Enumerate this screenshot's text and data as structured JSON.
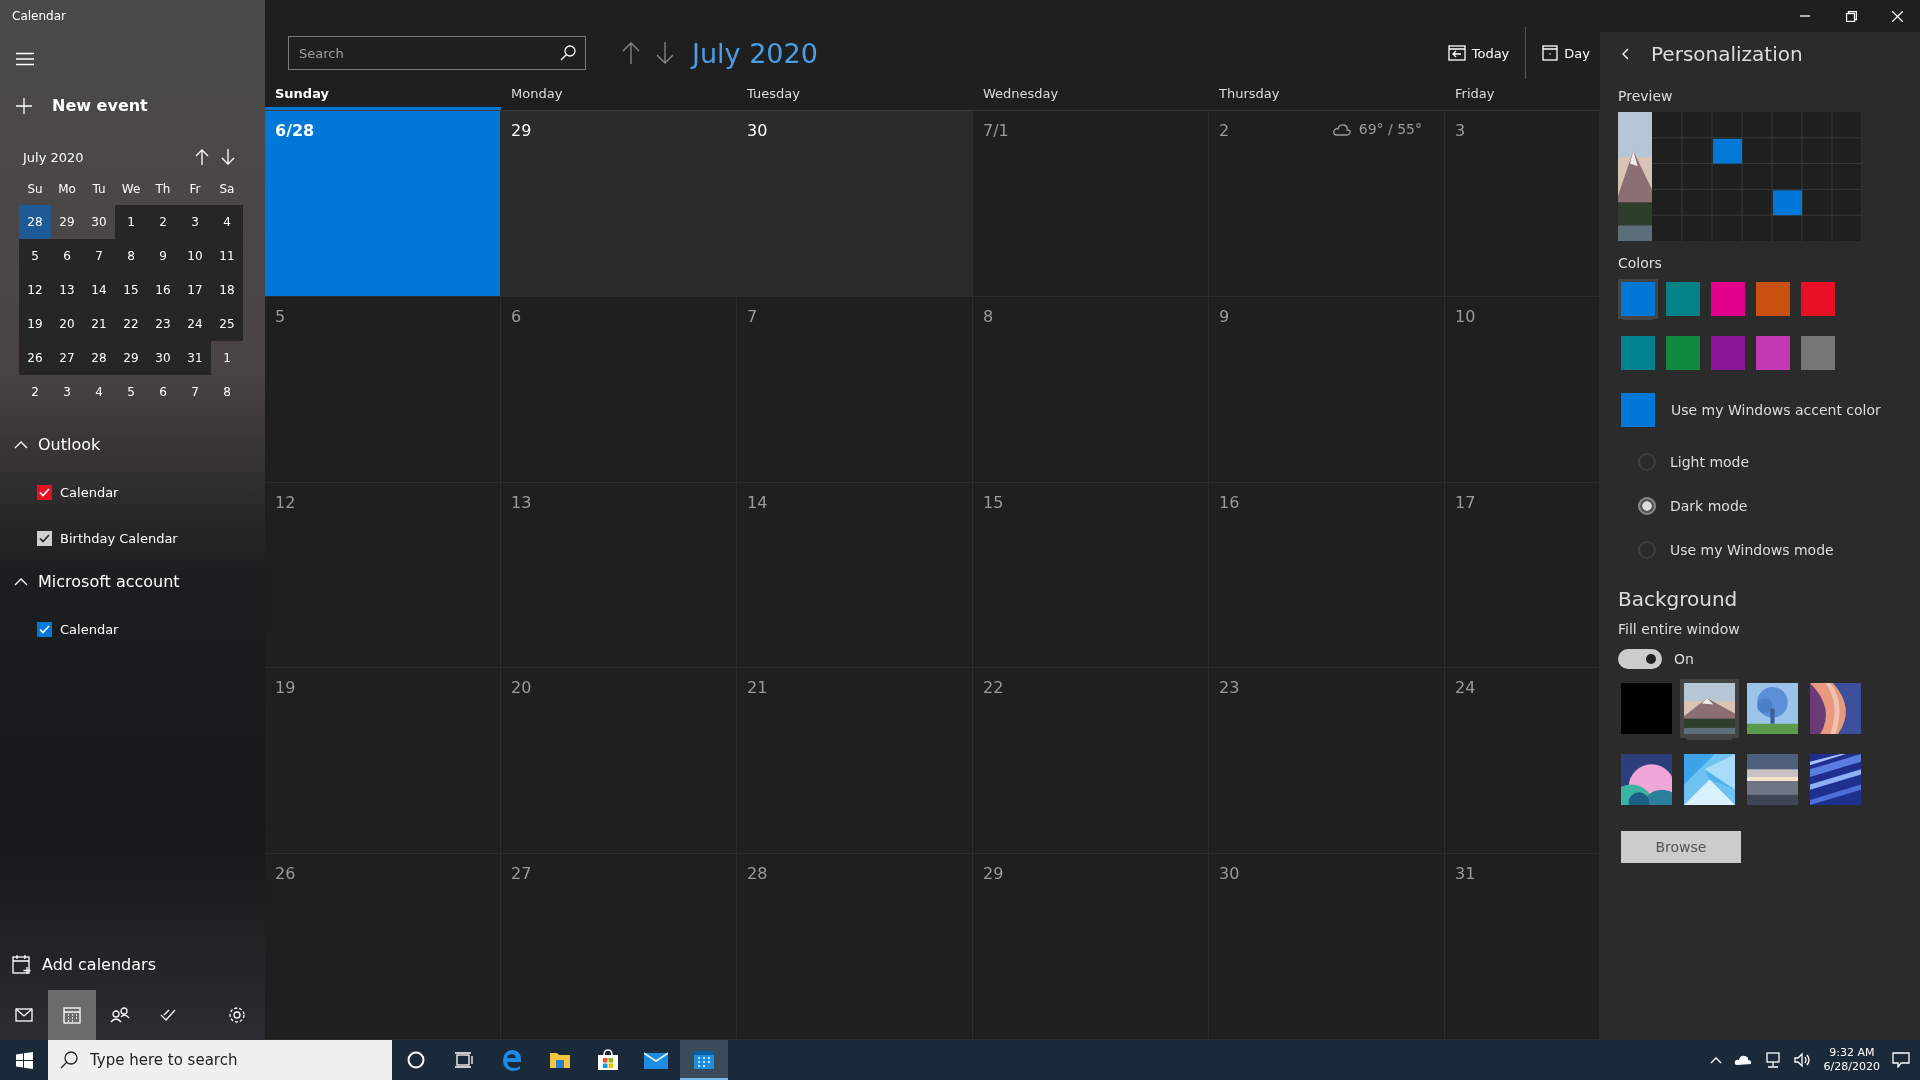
{
  "window": {
    "title": "Calendar"
  },
  "sidebar": {
    "new_event": "New event",
    "mini_calendar": {
      "title": "July 2020",
      "weekdays": [
        "Su",
        "Mo",
        "Tu",
        "We",
        "Th",
        "Fr",
        "Sa"
      ],
      "weeks": [
        [
          {
            "day": "28",
            "in_month": false,
            "selected": true
          },
          {
            "day": "29",
            "in_month": false,
            "selected": false
          },
          {
            "day": "30",
            "in_month": false,
            "selected": false
          },
          {
            "day": "1",
            "in_month": true,
            "selected": false
          },
          {
            "day": "2",
            "in_month": true,
            "selected": false
          },
          {
            "day": "3",
            "in_month": true,
            "selected": false
          },
          {
            "day": "4",
            "in_month": true,
            "selected": false
          }
        ],
        [
          {
            "day": "5",
            "in_month": true,
            "selected": false
          },
          {
            "day": "6",
            "in_month": true,
            "selected": false
          },
          {
            "day": "7",
            "in_month": true,
            "selected": false
          },
          {
            "day": "8",
            "in_month": true,
            "selected": false
          },
          {
            "day": "9",
            "in_month": true,
            "selected": false
          },
          {
            "day": "10",
            "in_month": true,
            "selected": false
          },
          {
            "day": "11",
            "in_month": true,
            "selected": false
          }
        ],
        [
          {
            "day": "12",
            "in_month": true,
            "selected": false
          },
          {
            "day": "13",
            "in_month": true,
            "selected": false
          },
          {
            "day": "14",
            "in_month": true,
            "selected": false
          },
          {
            "day": "15",
            "in_month": true,
            "selected": false
          },
          {
            "day": "16",
            "in_month": true,
            "selected": false
          },
          {
            "day": "17",
            "in_month": true,
            "selected": false
          },
          {
            "day": "18",
            "in_month": true,
            "selected": false
          }
        ],
        [
          {
            "day": "19",
            "in_month": true,
            "selected": false
          },
          {
            "day": "20",
            "in_month": true,
            "selected": false
          },
          {
            "day": "21",
            "in_month": true,
            "selected": false
          },
          {
            "day": "22",
            "in_month": true,
            "selected": false
          },
          {
            "day": "23",
            "in_month": true,
            "selected": false
          },
          {
            "day": "24",
            "in_month": true,
            "selected": false
          },
          {
            "day": "25",
            "in_month": true,
            "selected": false
          }
        ],
        [
          {
            "day": "26",
            "in_month": true,
            "selected": false
          },
          {
            "day": "27",
            "in_month": true,
            "selected": false
          },
          {
            "day": "28",
            "in_month": true,
            "selected": false
          },
          {
            "day": "29",
            "in_month": true,
            "selected": false
          },
          {
            "day": "30",
            "in_month": true,
            "selected": false
          },
          {
            "day": "31",
            "in_month": true,
            "selected": false
          },
          {
            "day": "1",
            "in_month": false,
            "selected": false
          }
        ],
        [
          {
            "day": "2",
            "in_month": false,
            "selected": false
          },
          {
            "day": "3",
            "in_month": false,
            "selected": false
          },
          {
            "day": "4",
            "in_month": false,
            "selected": false
          },
          {
            "day": "5",
            "in_month": false,
            "selected": false
          },
          {
            "day": "6",
            "in_month": false,
            "selected": false
          },
          {
            "day": "7",
            "in_month": false,
            "selected": false
          },
          {
            "day": "8",
            "in_month": false,
            "selected": false
          }
        ]
      ]
    },
    "accounts": [
      {
        "name": "Outlook",
        "expanded": true,
        "calendars": [
          {
            "name": "Calendar",
            "checked": true,
            "color": "#e81123"
          },
          {
            "name": "Birthday Calendar",
            "checked": true,
            "color": "#d0d0d0"
          }
        ]
      },
      {
        "name": "Microsoft account",
        "expanded": true,
        "calendars": [
          {
            "name": "Calendar",
            "checked": true,
            "color": "#0078d7"
          }
        ]
      }
    ],
    "add_calendars": "Add calendars",
    "nav": [
      {
        "kind": "mail",
        "selected": false
      },
      {
        "kind": "calendar",
        "selected": true
      },
      {
        "kind": "people",
        "selected": false
      },
      {
        "kind": "todo",
        "selected": false
      },
      {
        "kind": "settings",
        "selected": false
      }
    ]
  },
  "toolbar": {
    "search_placeholder": "Search",
    "title": "July 2020",
    "buttons": [
      {
        "kind": "today",
        "label": "Today"
      },
      {
        "kind": "day",
        "label": "Day"
      }
    ]
  },
  "month": {
    "weekdays": [
      {
        "label": "Sunday",
        "selected": true
      },
      {
        "label": "Monday",
        "selected": false
      },
      {
        "label": "Tuesday",
        "selected": false
      },
      {
        "label": "Wednesday",
        "selected": false
      },
      {
        "label": "Thursday",
        "selected": false
      },
      {
        "label": "Friday",
        "selected": false
      }
    ],
    "weeks": [
      [
        {
          "day": "6/28",
          "selected": true,
          "highlighted": true
        },
        {
          "day": "29",
          "selected": false,
          "highlighted": true
        },
        {
          "day": "30",
          "selected": false,
          "highlighted": true
        },
        {
          "day": "7/1",
          "selected": false,
          "highlighted": false
        },
        {
          "day": "2",
          "selected": false,
          "highlighted": false,
          "weather": "69° / 55°"
        },
        {
          "day": "3",
          "selected": false,
          "highlighted": false
        }
      ],
      [
        {
          "day": "5",
          "selected": false,
          "highlighted": false
        },
        {
          "day": "6",
          "selected": false,
          "highlighted": false
        },
        {
          "day": "7",
          "selected": false,
          "highlighted": false
        },
        {
          "day": "8",
          "selected": false,
          "highlighted": false
        },
        {
          "day": "9",
          "selected": false,
          "highlighted": false
        },
        {
          "day": "10",
          "selected": false,
          "highlighted": false
        }
      ],
      [
        {
          "day": "12",
          "selected": false,
          "highlighted": false
        },
        {
          "day": "13",
          "selected": false,
          "highlighted": false
        },
        {
          "day": "14",
          "selected": false,
          "highlighted": false
        },
        {
          "day": "15",
          "selected": false,
          "highlighted": false
        },
        {
          "day": "16",
          "selected": false,
          "highlighted": false
        },
        {
          "day": "17",
          "selected": false,
          "highlighted": false
        }
      ],
      [
        {
          "day": "19",
          "selected": false,
          "highlighted": false
        },
        {
          "day": "20",
          "selected": false,
          "highlighted": false
        },
        {
          "day": "21",
          "selected": false,
          "highlighted": false
        },
        {
          "day": "22",
          "selected": false,
          "highlighted": false
        },
        {
          "day": "23",
          "selected": false,
          "highlighted": false
        },
        {
          "day": "24",
          "selected": false,
          "highlighted": false
        }
      ],
      [
        {
          "day": "26",
          "selected": false,
          "highlighted": false
        },
        {
          "day": "27",
          "selected": false,
          "highlighted": false
        },
        {
          "day": "28",
          "selected": false,
          "highlighted": false
        },
        {
          "day": "29",
          "selected": false,
          "highlighted": false
        },
        {
          "day": "30",
          "selected": false,
          "highlighted": false
        },
        {
          "day": "31",
          "selected": false,
          "highlighted": false
        }
      ]
    ]
  },
  "personalization": {
    "title": "Personalization",
    "preview_label": "Preview",
    "colors_label": "Colors",
    "colors": [
      {
        "color": "#0078d7",
        "selected": true
      },
      {
        "color": "#038387",
        "selected": false
      },
      {
        "color": "#e3008c",
        "selected": false
      },
      {
        "color": "#ca5010",
        "selected": false
      },
      {
        "color": "#e81123",
        "selected": false
      },
      {
        "color": "#00838f",
        "selected": false
      },
      {
        "color": "#10893e",
        "selected": false
      },
      {
        "color": "#881798",
        "selected": false
      },
      {
        "color": "#c239b3",
        "selected": false
      },
      {
        "color": "#767676",
        "selected": false
      }
    ],
    "accent": {
      "label": "Use my Windows accent color",
      "color": "#0078d7"
    },
    "modes": [
      {
        "label": "Light mode",
        "selected": false
      },
      {
        "label": "Dark mode",
        "selected": true
      },
      {
        "label": "Use my Windows mode",
        "selected": false
      }
    ],
    "background": {
      "title": "Background",
      "fill_label": "Fill entire window",
      "fill": {
        "on": true,
        "label": "On"
      },
      "images": [
        {
          "kind": "black",
          "selected": false
        },
        {
          "kind": "mountain",
          "selected": true
        },
        {
          "kind": "tree",
          "selected": false
        },
        {
          "kind": "canyon",
          "selected": false
        },
        {
          "kind": "hills",
          "selected": false
        },
        {
          "kind": "facets",
          "selected": false
        },
        {
          "kind": "sunset",
          "selected": false
        },
        {
          "kind": "streaks",
          "selected": false
        }
      ],
      "browse": "Browse"
    }
  },
  "taskbar": {
    "search_placeholder": "Type here to search",
    "apps": [
      {
        "kind": "cortana",
        "selected": false
      },
      {
        "kind": "taskview",
        "selected": false
      },
      {
        "kind": "browser",
        "selected": false
      },
      {
        "kind": "folder",
        "selected": false
      },
      {
        "kind": "store",
        "selected": false
      },
      {
        "kind": "mail",
        "selected": false
      },
      {
        "kind": "calendar",
        "selected": true
      }
    ],
    "clock": {
      "time": "9:32 AM",
      "date": "6/28/2020"
    }
  }
}
